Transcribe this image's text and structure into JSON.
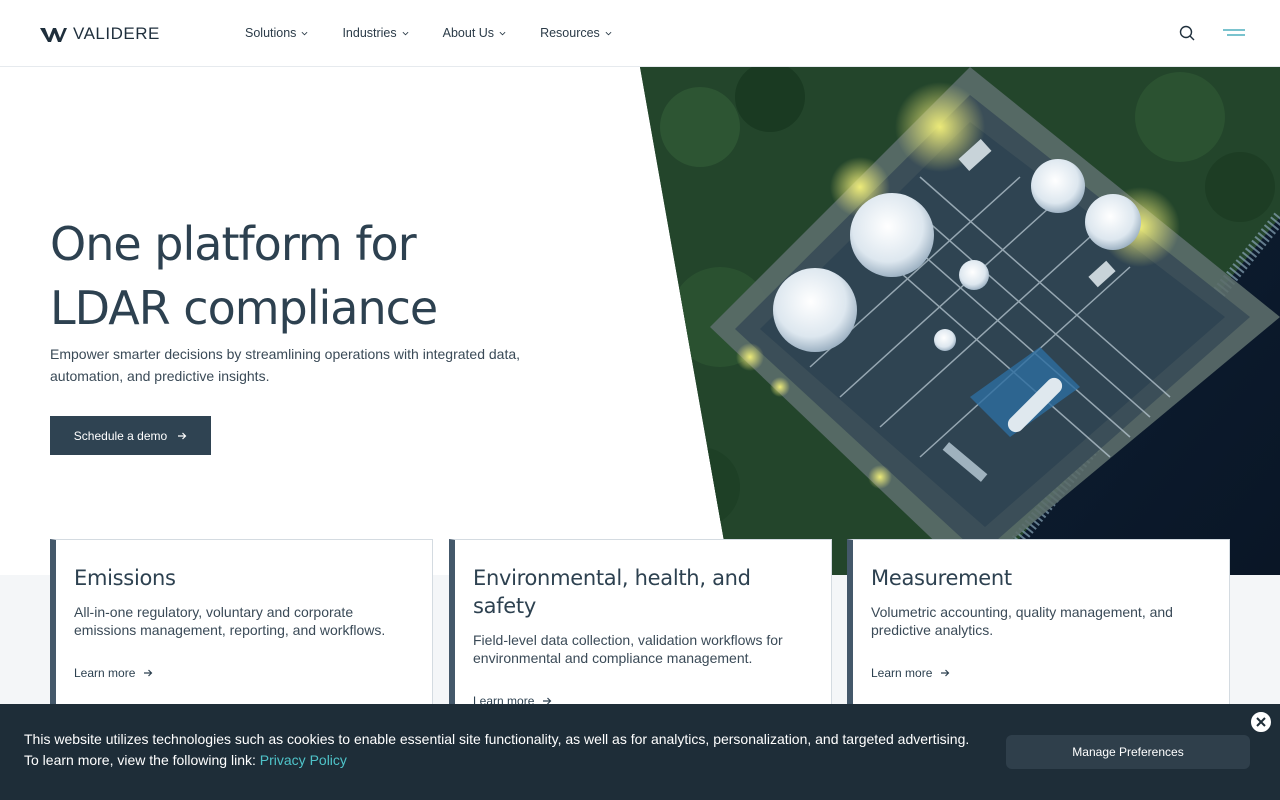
{
  "header": {
    "logo_text": "VALIDERE",
    "nav": [
      {
        "label": "Solutions"
      },
      {
        "label": "Industries"
      },
      {
        "label": "About Us"
      },
      {
        "label": "Resources"
      }
    ],
    "icons": [
      "search-icon",
      "menu-icon"
    ]
  },
  "hero": {
    "title_line1": "One platform for",
    "title_line2": "LDAR compliance",
    "subtitle": "Empower smarter decisions by streamlining operations with integrated data, automation, and predictive insights.",
    "cta_label": "Schedule a demo",
    "image_icon": "aerial-industrial-facility-image"
  },
  "cards": [
    {
      "title": "Emissions",
      "description": "All-in-one regulatory, voluntary and corporate emissions management, reporting, and workflows.",
      "link": "Learn more"
    },
    {
      "title": "Environmental, health, and safety",
      "description": "Field-level data collection, validation workflows for environmental and compliance management.",
      "link": "Learn more"
    },
    {
      "title": "Measurement",
      "description": "Volumetric accounting, quality management, and predictive analytics.",
      "link": "Learn more"
    }
  ],
  "cookie": {
    "text_line1": "This website utilizes technologies such as cookies to enable essential site functionality, as well as for analytics, personalization, and targeted advertising.",
    "text_line2": "To learn more, view the following link: ",
    "link": "Privacy Policy",
    "manage_label": "Manage Preferences"
  },
  "colors": {
    "brand_dark": "#2f4352",
    "banner_bg": "#1e2d38",
    "link_teal": "#4fc3c9",
    "card_accent": "#44586a"
  }
}
